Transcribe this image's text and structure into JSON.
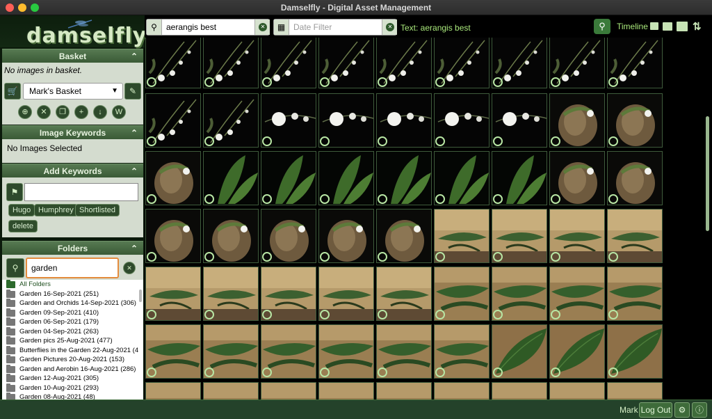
{
  "window": {
    "title": "Damselfly - Digital Asset Management"
  },
  "logo": {
    "text": "damselfly"
  },
  "basket": {
    "header": "Basket",
    "empty_note": "No images in basket.",
    "selected": "Mark's Basket"
  },
  "image_keywords": {
    "header": "Image Keywords",
    "note": "No Images Selected"
  },
  "add_keywords": {
    "header": "Add Keywords",
    "input_value": "",
    "chips": [
      "Hugo",
      "Humphrey",
      "Shortlisted",
      "delete"
    ]
  },
  "folders": {
    "header": "Folders",
    "search_value": "garden",
    "all_label": "All Folders",
    "items": [
      "Garden 16-Sep-2021 (251)",
      "Garden and Orchids 14-Sep-2021 (306)",
      "Garden 09-Sep-2021 (410)",
      "Garden 06-Sep-2021 (179)",
      "Garden 04-Sep-2021 (263)",
      "Garden pics 25-Aug-2021 (477)",
      "Butterflies in the Garden 22-Aug-2021 (4",
      "Garden Pictures 20-Aug-2021 (153)",
      "Garden and Aerobin 16-Aug-2021 (286)",
      "Garden 12-Aug-2021 (305)",
      "Garden 10-Aug-2021 (293)",
      "Garden 08-Aug-2021 (48)"
    ]
  },
  "search": {
    "text_value": "aerangis best",
    "date_placeholder": "Date Filter",
    "filter_label": "Text: aerangis best",
    "timeline_label": "Timeline"
  },
  "grid": {
    "rows": [
      [
        "spray",
        "spray",
        "spray",
        "spray",
        "spray",
        "spray",
        "spray",
        "spray",
        "spray"
      ],
      [
        "spray",
        "spray",
        "flower",
        "flower",
        "flower",
        "flower",
        "flower",
        "mounted",
        "mounted"
      ],
      [
        "mounted",
        "leaf",
        "leaf",
        "leaf",
        "leaf",
        "leaf",
        "leaf",
        "mounted",
        "mounted"
      ],
      [
        "mounted",
        "mounted",
        "mounted",
        "mounted",
        "mounted",
        "bark",
        "bark",
        "bark",
        "bark"
      ],
      [
        "bark",
        "bark",
        "bark",
        "bark",
        "bark",
        "leafbark",
        "leafbark",
        "leafbark",
        "leafbark"
      ],
      [
        "leafbark",
        "leafbark",
        "leafbark",
        "leafbark",
        "leafbark",
        "leafbark",
        "bigleaf",
        "bigleaf",
        "bigleaf"
      ],
      [
        "leafbark",
        "leafbark",
        "leafbark",
        "leafbark",
        "leafbark",
        "leafbark",
        "leafbark",
        "leafbark",
        "leafbark"
      ]
    ]
  },
  "footer": {
    "user": "Mark",
    "logout_label": "Log Out"
  },
  "colors": {
    "accent_green": "#a9e87b",
    "panel_header": "#4b6e46",
    "footer_bg": "#24422a"
  },
  "icons": {
    "basket": "basket-icon",
    "search": "search-icon",
    "calendar": "calendar-icon",
    "tag": "tag-icon",
    "folder": "folder-icon",
    "settings": "gears-icon",
    "info": "info-icon"
  }
}
